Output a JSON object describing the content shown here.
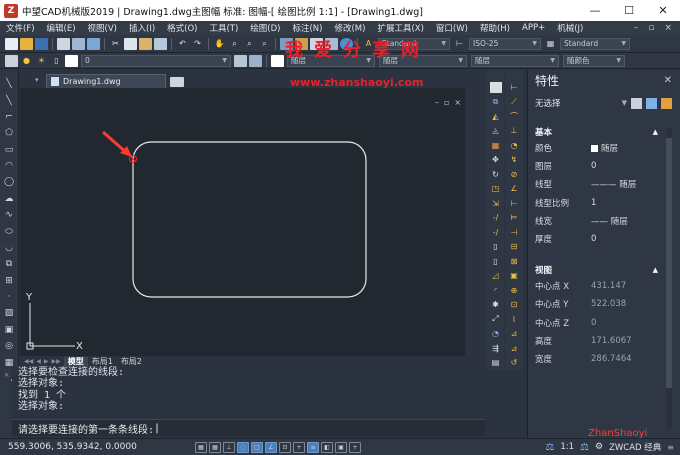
{
  "titlebar": {
    "title": "中望CAD机械版2019 | Drawing1.dwg主图幅  标准: 图幅-[ 绘图比例 1:1] - [Drawing1.dwg]",
    "minimize": "—",
    "maximize": "☐",
    "close": "✕"
  },
  "menu": [
    "文件(F)",
    "编辑(E)",
    "视图(V)",
    "插入(I)",
    "格式(O)",
    "工具(T)",
    "绘图(D)",
    "标注(N)",
    "修改(M)",
    "扩展工具(X)",
    "窗口(W)",
    "帮助(H)",
    "APP+",
    "机械(J)"
  ],
  "menu_right": [
    "–",
    "▫",
    "×"
  ],
  "toolbar": {
    "text_style": "Standard",
    "dim_style": "ISO-25",
    "table_style": "Standard",
    "layer_value": "0",
    "color_value": "随层",
    "linetype_value": "随层",
    "lineweight_value": "随层",
    "plotstyle_value": "随颜色"
  },
  "watermark": {
    "text": "我爱分享网",
    "url": "www.zhanshaoyi.com"
  },
  "tabs": {
    "doc_tab": "Drawing1.dwg",
    "tab_menu": "▾"
  },
  "view_controls": [
    "–",
    "▫",
    "×"
  ],
  "layout_tabs": [
    "模型",
    "布局1",
    "布局2"
  ],
  "layout_nav": [
    "◀◀",
    "◀",
    "▶",
    "▶▶"
  ],
  "axis": {
    "x": "X",
    "y": "Y"
  },
  "command": {
    "history": [
      "选择要检查连接的线段:",
      "选择对象:",
      "找到 1 个",
      "选择对象:"
    ],
    "prompt": "请选择要连接的第一条条线段:"
  },
  "properties": {
    "title": "特性",
    "selection": "无选择",
    "section_basic": "基本",
    "basic_rows": [
      {
        "key": "颜色",
        "value": "随层",
        "swatch": true
      },
      {
        "key": "图层",
        "value": "0"
      },
      {
        "key": "线型",
        "value": "——— 随层"
      },
      {
        "key": "线型比例",
        "value": "1"
      },
      {
        "key": "线宽",
        "value": "—— 随层"
      },
      {
        "key": "厚度",
        "value": "0"
      }
    ],
    "section_view": "视图",
    "view_rows": [
      {
        "key": "中心点 X",
        "value": "431.147"
      },
      {
        "key": "中心点 Y",
        "value": "522.038"
      },
      {
        "key": "中心点 Z",
        "value": "0"
      },
      {
        "key": "高度",
        "value": "171.6067"
      },
      {
        "key": "宽度",
        "value": "286.7464"
      }
    ]
  },
  "status": {
    "coords": "559.3006, 535.9342, 0.0000",
    "scale": "1:1",
    "brand": "ZWCAD 经典"
  },
  "corner_watermark": "ZhanShaoyi"
}
